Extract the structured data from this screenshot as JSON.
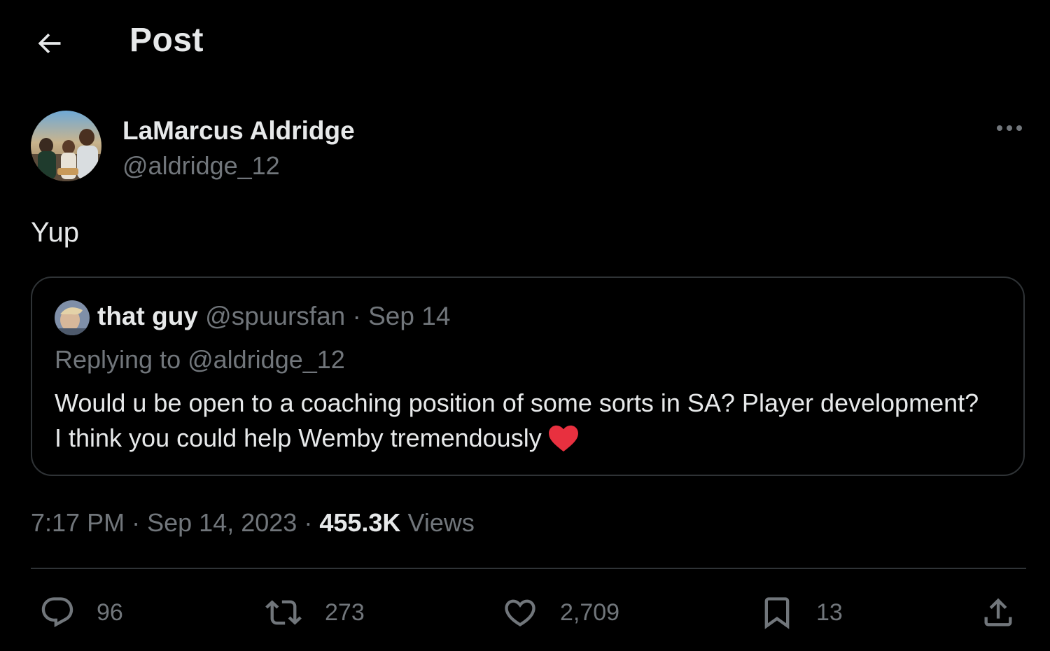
{
  "header": {
    "back_icon": "arrow-left-icon",
    "title": "Post"
  },
  "author": {
    "name": "LaMarcus Aldridge",
    "handle": "@aldridge_12",
    "more_icon": "more-horizontal-icon"
  },
  "post": {
    "text": "Yup"
  },
  "quote": {
    "name": "that guy",
    "handle": "@spuursfan",
    "separator": "·",
    "date": "Sep 14",
    "replying_to": "Replying to @aldridge_12",
    "body": "Would u be open to a coaching position of some sorts in SA? Player development? I think you could help Wemby tremendously",
    "emoji": "heart-emoji",
    "heart_color": "#e8303f"
  },
  "meta": {
    "time": "7:17 PM",
    "separator": "·",
    "date": "Sep 14, 2023",
    "views_count": "455.3K",
    "views_label": "Views"
  },
  "actions": {
    "replies": "96",
    "reposts": "273",
    "likes": "2,709",
    "bookmarks": "13"
  },
  "colors": {
    "background": "#000000",
    "text_primary": "#e7e9ea",
    "text_secondary": "#71767b",
    "border": "#2f3336"
  }
}
